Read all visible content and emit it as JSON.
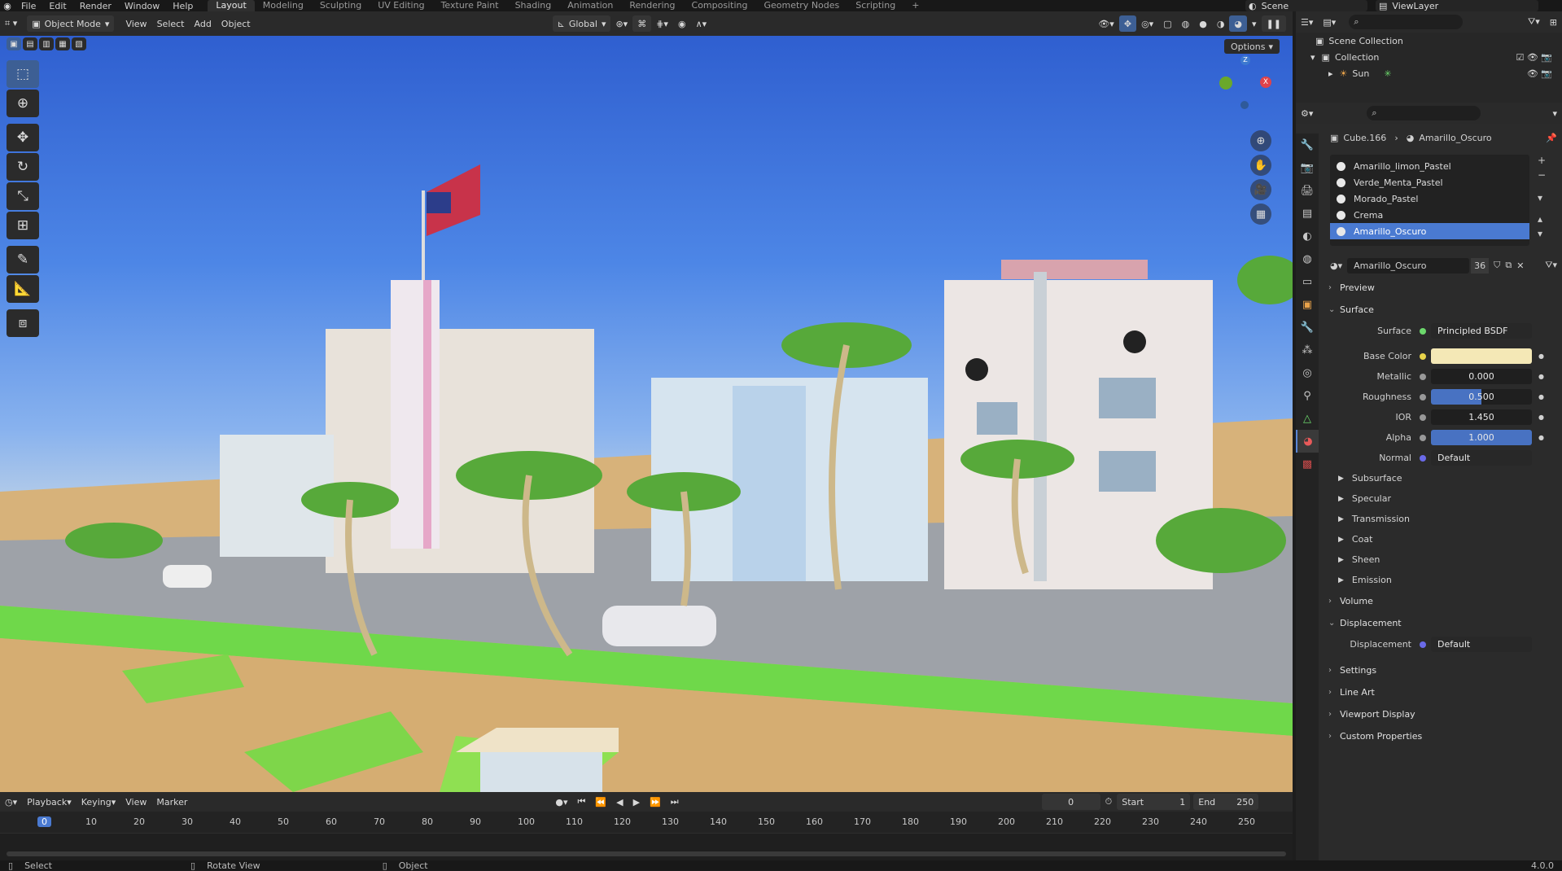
{
  "top_menu": [
    "File",
    "Edit",
    "Render",
    "Window",
    "Help"
  ],
  "workspaces": [
    "Layout",
    "Modeling",
    "Sculpting",
    "UV Editing",
    "Texture Paint",
    "Shading",
    "Animation",
    "Rendering",
    "Compositing",
    "Geometry Nodes",
    "Scripting"
  ],
  "active_workspace": "Layout",
  "scene_name": "Scene",
  "view_layer": "ViewLayer",
  "viewport_header": {
    "mode": "Object Mode",
    "menus": [
      "View",
      "Select",
      "Add",
      "Object"
    ],
    "transform_orientation": "Global",
    "options_label": "Options"
  },
  "gizmo_axes": {
    "z": "Z",
    "x": "X"
  },
  "outliner": {
    "scene_collection": "Scene Collection",
    "collection": "Collection",
    "sun": "Sun"
  },
  "properties": {
    "object_name": "Cube.166",
    "material_name": "Amarillo_Oscuro",
    "material_slots": [
      "Amarillo_limon_Pastel",
      "Verde_Menta_Pastel",
      "Morado_Pastel",
      "Crema",
      "Amarillo_Oscuro"
    ],
    "selected_slot": "Amarillo_Oscuro",
    "material_users": "36",
    "sections": {
      "preview": "Preview",
      "surface": "Surface",
      "volume": "Volume",
      "displacement": "Displacement",
      "settings": "Settings",
      "line_art": "Line Art",
      "viewport_display": "Viewport Display",
      "custom_properties": "Custom Properties"
    },
    "surface_label": "Surface",
    "surface_shader": "Principled BSDF",
    "fields": {
      "base_color_label": "Base Color",
      "base_color": "#f4e8b6",
      "metallic_label": "Metallic",
      "metallic": "0.000",
      "roughness_label": "Roughness",
      "roughness": "0.500",
      "ior_label": "IOR",
      "ior": "1.450",
      "alpha_label": "Alpha",
      "alpha": "1.000",
      "normal_label": "Normal",
      "normal": "Default"
    },
    "subsections": [
      "Subsurface",
      "Specular",
      "Transmission",
      "Coat",
      "Sheen",
      "Emission"
    ],
    "displacement_label": "Displacement",
    "displacement_value": "Default"
  },
  "timeline": {
    "menus": [
      "Playback",
      "Keying",
      "View",
      "Marker"
    ],
    "current_frame": "0",
    "start_label": "Start",
    "start": "1",
    "end_label": "End",
    "end": "250",
    "ruler": [
      "0",
      "10",
      "20",
      "30",
      "40",
      "50",
      "60",
      "70",
      "80",
      "90",
      "100",
      "110",
      "120",
      "130",
      "140",
      "150",
      "160",
      "170",
      "180",
      "190",
      "200",
      "210",
      "220",
      "230",
      "240",
      "250"
    ]
  },
  "status_bar": {
    "select": "Select",
    "rotate": "Rotate View",
    "object": "Object",
    "version": "4.0.0"
  },
  "colors": {
    "accent": "#4a7ad1",
    "x_axis": "#e0424a",
    "y_axis": "#6aa82a",
    "z_axis": "#3d79cf"
  }
}
